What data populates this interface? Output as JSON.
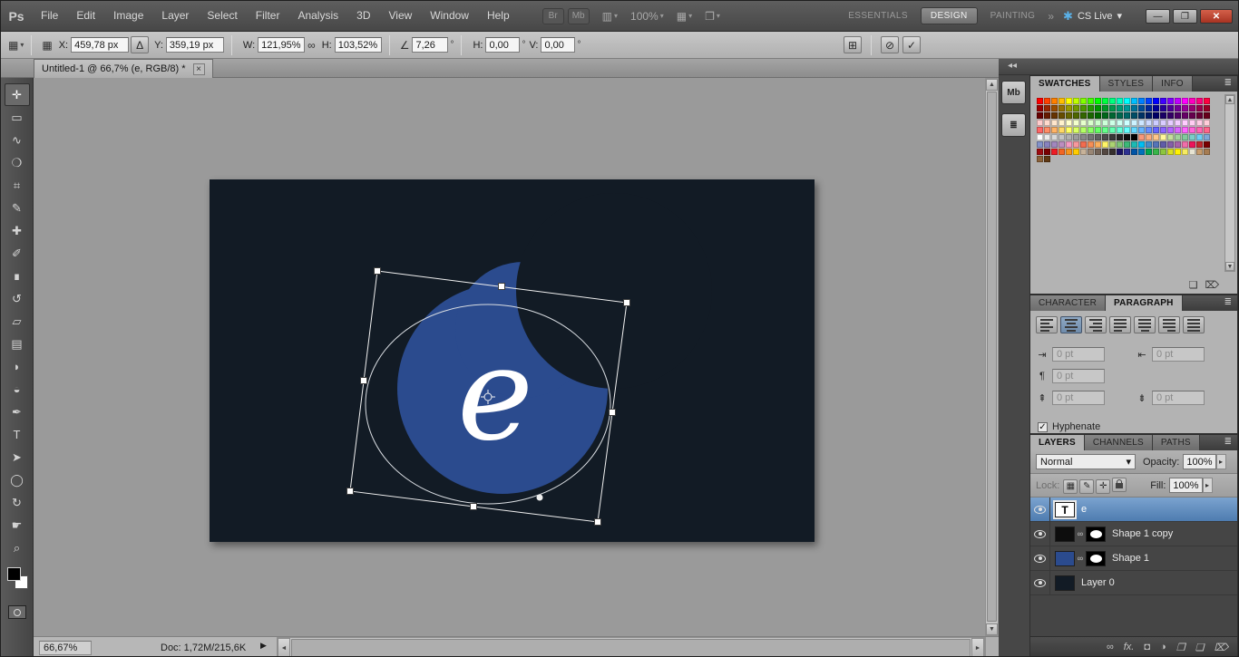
{
  "titlebar": {
    "logo": "Ps",
    "menus": [
      "File",
      "Edit",
      "Image",
      "Layer",
      "Select",
      "Filter",
      "Analysis",
      "3D",
      "View",
      "Window",
      "Help"
    ],
    "app_buttons": [
      "Br",
      "Mb"
    ],
    "icons": {
      "arrange": "▥",
      "view_extras": "▦",
      "screen_mode": "❒",
      "dropdown": "▾"
    },
    "zoom_dropdown": "100%",
    "workspaces": [
      "ESSENTIALS",
      "DESIGN",
      "PAINTING"
    ],
    "active_workspace": "DESIGN",
    "overflow": "»",
    "cs_live": "CS Live",
    "window_buttons": {
      "minimize": "—",
      "restore": "❐",
      "close": "✕"
    }
  },
  "options_bar": {
    "preset_icon": "▦",
    "ref_point_icon": "▦",
    "x_label": "X:",
    "x": "459,78 px",
    "delta": "Δ",
    "y_label": "Y:",
    "y": "359,19 px",
    "w_label": "W:",
    "w": "121,95%",
    "link_icon": "∞",
    "h_label": "H:",
    "h": "103,52%",
    "angle_icon": "∠",
    "angle": "7,26",
    "deg": "°",
    "hskew_label": "H:",
    "hskew": "0,00",
    "vskew_label": "V:",
    "vskew": "0,00",
    "warp_icon": "⊞",
    "cancel_icon": "⊘",
    "commit_icon": "✓"
  },
  "document_tab": {
    "title": "Untitled-1 @ 66,7% (e, RGB/8) *",
    "close": "×"
  },
  "tools": [
    {
      "name": "move-tool",
      "glyph": "✛",
      "active": true
    },
    {
      "name": "rectangular-marquee-tool",
      "glyph": "▭"
    },
    {
      "name": "lasso-tool",
      "glyph": "∿"
    },
    {
      "name": "quick-selection-tool",
      "glyph": "❍"
    },
    {
      "name": "crop-tool",
      "glyph": "⌗"
    },
    {
      "name": "eyedropper-tool",
      "glyph": "✎"
    },
    {
      "name": "spot-healing-brush-tool",
      "glyph": "✚"
    },
    {
      "name": "brush-tool",
      "glyph": "✐"
    },
    {
      "name": "clone-stamp-tool",
      "glyph": "∎"
    },
    {
      "name": "history-brush-tool",
      "glyph": "↺"
    },
    {
      "name": "eraser-tool",
      "glyph": "▱"
    },
    {
      "name": "gradient-tool",
      "glyph": "▤"
    },
    {
      "name": "blur-tool",
      "glyph": "◗"
    },
    {
      "name": "dodge-tool",
      "glyph": "◒"
    },
    {
      "name": "pen-tool",
      "glyph": "✒"
    },
    {
      "name": "type-tool",
      "glyph": "T"
    },
    {
      "name": "path-selection-tool",
      "glyph": "➤"
    },
    {
      "name": "ellipse-tool",
      "glyph": "◯"
    },
    {
      "name": "rotate-view-tool",
      "glyph": "↻"
    },
    {
      "name": "hand-tool",
      "glyph": "☛"
    },
    {
      "name": "zoom-tool",
      "glyph": "⌕"
    }
  ],
  "canvas": {
    "letter": "e",
    "doc_color": "#121b25",
    "shape_color": "#2b4b8e"
  },
  "dock": {
    "collapse": "◂◂",
    "icon_buttons": [
      {
        "name": "mini-bridge-panel-icon",
        "label": "Mb"
      },
      {
        "name": "layer-comps-panel-icon",
        "label": "≣"
      }
    ]
  },
  "swatches_panel": {
    "tabs": [
      "SWATCHES",
      "STYLES",
      "INFO"
    ],
    "active_tab": "SWATCHES",
    "menu_icon": "≣",
    "new_icon": "❏",
    "trash_icon": "⌦",
    "rows": [
      [
        "#ff0000",
        "#ff4000",
        "#ff8000",
        "#ffbf00",
        "#ffff00",
        "#bfff00",
        "#80ff00",
        "#40ff00",
        "#00ff00",
        "#00ff40",
        "#00ff80",
        "#00ffbf",
        "#00ffff",
        "#00bfff",
        "#0080ff",
        "#0040ff",
        "#0000ff",
        "#4000ff",
        "#8000ff",
        "#bf00ff",
        "#ff00ff",
        "#ff00bf",
        "#ff0080",
        "#ff0040"
      ],
      [
        "#990000",
        "#992600",
        "#994d00",
        "#997300",
        "#999900",
        "#739900",
        "#4d9900",
        "#269900",
        "#009900",
        "#009926",
        "#00994d",
        "#009973",
        "#009999",
        "#007399",
        "#004d99",
        "#002699",
        "#000099",
        "#260099",
        "#4d0099",
        "#730099",
        "#990099",
        "#990073",
        "#99004d",
        "#990026"
      ],
      [
        "#660000",
        "#661a00",
        "#663300",
        "#664d00",
        "#666600",
        "#4d6600",
        "#336600",
        "#1a6600",
        "#006600",
        "#00661a",
        "#006633",
        "#00664d",
        "#006666",
        "#004d66",
        "#003366",
        "#001a66",
        "#000066",
        "#1a0066",
        "#330066",
        "#4d0066",
        "#660066",
        "#66004d",
        "#660033",
        "#66001a"
      ],
      [
        "#ffcccc",
        "#ffd9cc",
        "#ffe6cc",
        "#fff2cc",
        "#ffffcc",
        "#f2ffcc",
        "#e6ffcc",
        "#d9ffcc",
        "#ccffcc",
        "#ccffd9",
        "#ccffe6",
        "#ccfff2",
        "#ccffff",
        "#ccf2ff",
        "#cce6ff",
        "#ccd9ff",
        "#ccccff",
        "#d9ccff",
        "#e6ccff",
        "#f2ccff",
        "#ffccff",
        "#ffccf2",
        "#ffcce6",
        "#ffccd9"
      ],
      [
        "#ff6666",
        "#ff8c66",
        "#ffb366",
        "#ffd966",
        "#ffff66",
        "#d9ff66",
        "#b3ff66",
        "#8cff66",
        "#66ff66",
        "#66ff8c",
        "#66ffb3",
        "#66ffd9",
        "#66ffff",
        "#66d9ff",
        "#66b3ff",
        "#668cff",
        "#6666ff",
        "#8c66ff",
        "#b366ff",
        "#d966ff",
        "#ff66ff",
        "#ff66d9",
        "#ff66b3",
        "#ff668c"
      ],
      [
        "#ffffff",
        "#ebebeb",
        "#d8d8d8",
        "#c4c4c4",
        "#b0b0b0",
        "#9c9c9c",
        "#888888",
        "#747474",
        "#606060",
        "#4c4c4c",
        "#383838",
        "#242424",
        "#101010",
        "#000000",
        "#f7977a",
        "#f9ad81",
        "#fdc68a",
        "#fff79a",
        "#c4df9b",
        "#a2d39c",
        "#82ca9d",
        "#7bcdc8",
        "#6ecff6",
        "#7ea7d8"
      ],
      [
        "#8493ca",
        "#8882be",
        "#a187be",
        "#bc8dbf",
        "#f49ac2",
        "#f6989d",
        "#f26c4f",
        "#f68e55",
        "#fbaf5c",
        "#fff467",
        "#acd372",
        "#7cc576",
        "#3bb878",
        "#1cbbb4",
        "#00bff3",
        "#438ccb",
        "#5574b9",
        "#605ca8",
        "#855fa8",
        "#a763a8",
        "#f06eaa",
        "#ed145b",
        "#c1272d",
        "#790000"
      ],
      [
        "#9e0b0f",
        "#790000",
        "#ed1c24",
        "#f26522",
        "#f7941d",
        "#ffcc00",
        "#c7b299",
        "#998675",
        "#736357",
        "#534741",
        "#362f2d",
        "#1b1464",
        "#2e3192",
        "#0054a6",
        "#0072bc",
        "#00a651",
        "#39b54a",
        "#8dc63f",
        "#d9e021",
        "#fff200",
        "#f6eb61",
        "#e7e4d3",
        "#c69c6d",
        "#a67c52"
      ],
      [
        "#8c6239",
        "#603913"
      ]
    ]
  },
  "type_panel": {
    "tabs": [
      "CHARACTER",
      "PARAGRAPH"
    ],
    "active_tab": "PARAGRAPH",
    "menu_icon": "≣",
    "alignments": [
      {
        "name": "align-left",
        "type": "left"
      },
      {
        "name": "align-center",
        "type": "center",
        "active": true
      },
      {
        "name": "align-right",
        "type": "right"
      },
      {
        "name": "justify-last-left",
        "type": "jleft"
      },
      {
        "name": "justify-last-center",
        "type": "jcenter"
      },
      {
        "name": "justify-last-right",
        "type": "jright"
      },
      {
        "name": "justify-all",
        "type": "jall"
      }
    ],
    "fields": [
      {
        "name": "indent-left",
        "icon": "⇥",
        "value": "0 pt"
      },
      {
        "name": "indent-right",
        "icon": "⇤",
        "value": "0 pt"
      },
      {
        "name": "first-line-indent",
        "icon": "¶",
        "value": "0 pt"
      },
      {
        "name": "space-before",
        "icon": "⇞",
        "value": "0 pt"
      },
      {
        "name": "space-after",
        "icon": "⇟",
        "value": "0 pt"
      }
    ],
    "hyphenate_label": "Hyphenate",
    "hyphenate_checked": true,
    "check_glyph": "✓"
  },
  "layers_panel": {
    "tabs": [
      "LAYERS",
      "CHANNELS",
      "PATHS"
    ],
    "active_tab": "LAYERS",
    "menu_icon": "≣",
    "blend_mode": "Normal",
    "dropdown_arrow": "▾",
    "opacity_label": "Opacity:",
    "opacity": "100%",
    "lock_label": "Lock:",
    "fill_label": "Fill:",
    "fill": "100%",
    "spinner_arrow": "▸",
    "lock_icons": [
      {
        "name": "lock-transparency-icon",
        "glyph": "▦"
      },
      {
        "name": "lock-pixels-icon",
        "glyph": "✎"
      },
      {
        "name": "lock-position-icon",
        "glyph": "✛"
      },
      {
        "name": "lock-all-icon",
        "glyph": "padlock"
      }
    ],
    "layers": [
      {
        "name": "e",
        "kind": "text",
        "selected": true,
        "visible": true
      },
      {
        "name": "Shape 1 copy",
        "kind": "shape",
        "thumb": "#0d0d0d",
        "mask": true,
        "visible": true
      },
      {
        "name": "Shape 1",
        "kind": "shape",
        "thumb": "#2b4b8e",
        "mask": true,
        "visible": true
      },
      {
        "name": "Layer 0",
        "kind": "bitmap",
        "thumb": "#121b25",
        "visible": true
      }
    ],
    "bottom_icons": [
      {
        "name": "link-layers-icon",
        "glyph": "∞"
      },
      {
        "name": "layer-style-icon",
        "glyph": "fx."
      },
      {
        "name": "add-mask-icon",
        "glyph": "◘"
      },
      {
        "name": "adjustment-layer-icon",
        "glyph": "◑"
      },
      {
        "name": "layer-group-icon",
        "glyph": "❒"
      },
      {
        "name": "new-layer-icon",
        "glyph": "❏"
      },
      {
        "name": "delete-layer-icon",
        "glyph": "⌦"
      }
    ]
  },
  "statusbar": {
    "zoom": "66,67%",
    "doc": "Doc: 1,72M/215,6K",
    "menu_arrow": "▶"
  }
}
